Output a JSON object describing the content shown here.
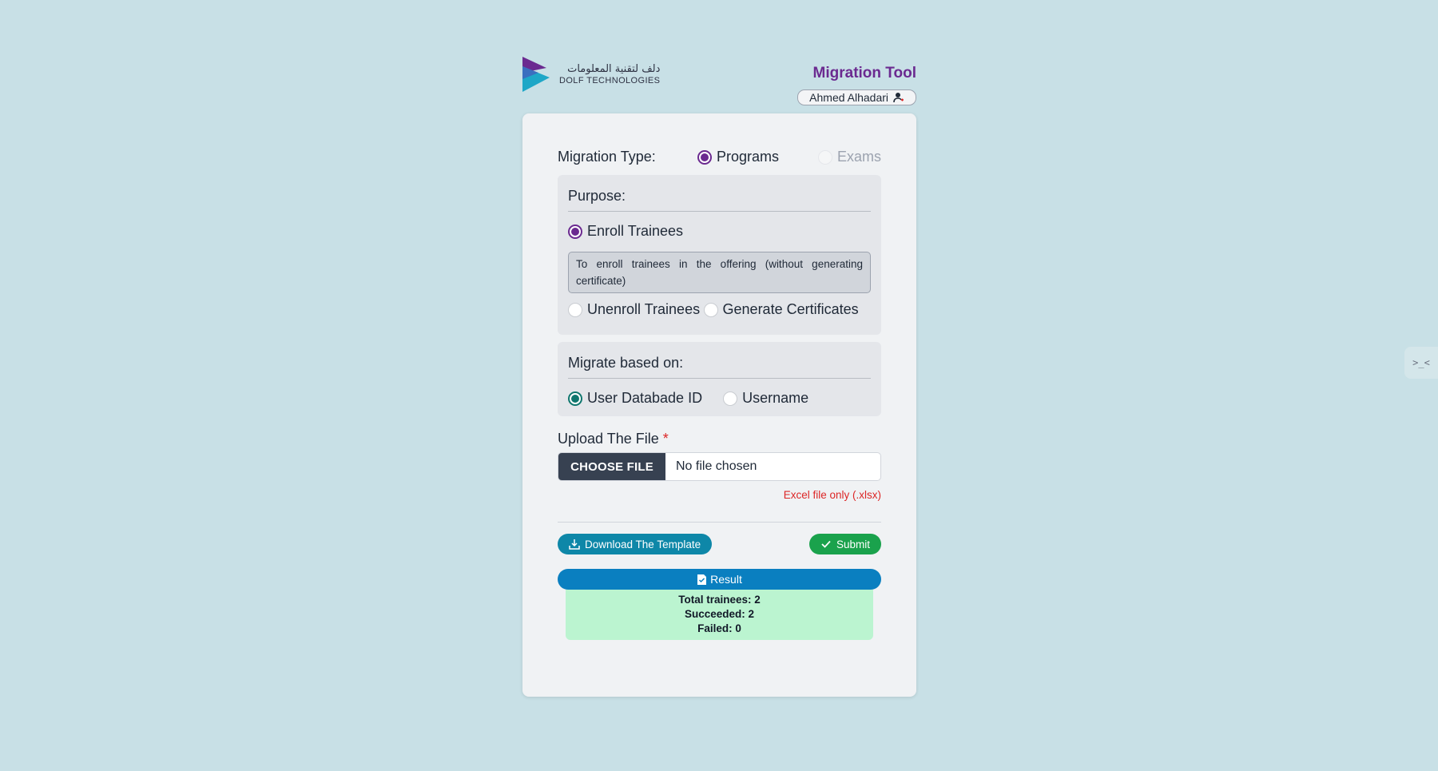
{
  "brand": {
    "arabic_name": "دلف لتقنية المعلومات",
    "english_name": "DOLF TECHNOLOGIES",
    "logo_icon": "dolf-logo"
  },
  "header": {
    "title": "Migration Tool",
    "user_name": "Ahmed Alhadari",
    "user_icon": "user-icon"
  },
  "migration_type": {
    "label": "Migration Type:",
    "options": [
      {
        "label": "Programs",
        "selected": true
      },
      {
        "label": "Exams",
        "selected": false,
        "disabled": true
      }
    ]
  },
  "purpose": {
    "title": "Purpose:",
    "options": [
      {
        "label": "Enroll Trainees",
        "selected": true
      },
      {
        "label": "Unenroll Trainees",
        "selected": false
      },
      {
        "label": "Generate Certificates",
        "selected": false
      }
    ],
    "description": "To enroll trainees in the offering (without generating certificate)"
  },
  "migrate_based_on": {
    "title": "Migrate based on:",
    "options": [
      {
        "label": "User Databade ID",
        "selected": true
      },
      {
        "label": "Username",
        "selected": false
      }
    ]
  },
  "upload": {
    "label": "Upload The File",
    "required_mark": "*",
    "button_label": "CHOOSE FILE",
    "file_status": "No file chosen",
    "hint": "Excel file only (.xlsx)"
  },
  "actions": {
    "download_label": "Download The Template",
    "submit_label": "Submit"
  },
  "result": {
    "title": "Result",
    "lines": [
      "Total trainees: 2",
      "Succeeded: 2",
      "Failed: 0"
    ]
  },
  "side_tab": {
    "glyph": ">_<"
  },
  "colors": {
    "background": "#c8e0e6",
    "brand_purple": "#6b2a90",
    "download_teal": "#0e87a8",
    "submit_green": "#1aa24c",
    "result_blue": "#0a7fc0",
    "result_bg": "#bbf4d0",
    "error_red": "#dc2626"
  }
}
